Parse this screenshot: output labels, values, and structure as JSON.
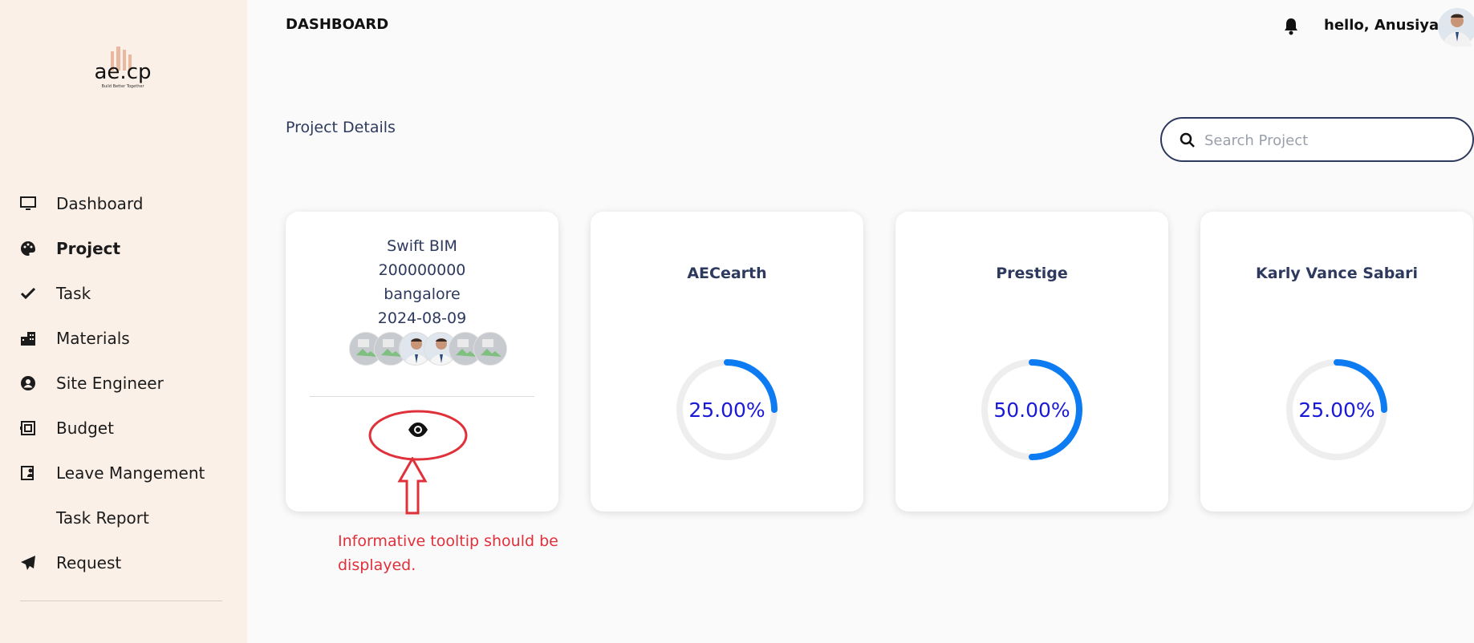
{
  "brand": {
    "logo_text": "ae.cp",
    "tagline": "Build Better Together",
    "accent": "#0d7cf2"
  },
  "sidebar": {
    "items": [
      {
        "label": "Dashboard",
        "icon": "monitor-icon",
        "active": false
      },
      {
        "label": "Project",
        "icon": "palette-icon",
        "active": true
      },
      {
        "label": "Task",
        "icon": "check-icon",
        "active": false
      },
      {
        "label": "Materials",
        "icon": "building-icon",
        "active": false
      },
      {
        "label": "Site Engineer",
        "icon": "user-circle-icon",
        "active": false
      },
      {
        "label": "Budget",
        "icon": "receipt-icon",
        "active": false
      },
      {
        "label": "Leave Mangement",
        "icon": "leave-icon",
        "active": false
      },
      {
        "label": "Task Report",
        "icon": "",
        "active": false
      },
      {
        "label": "Request",
        "icon": "send-icon",
        "active": false
      }
    ]
  },
  "header": {
    "title": "DASHBOARD",
    "greeting": "hello, Anusiya!",
    "bell_icon": "bell-icon",
    "avatar_icon": "user-avatar"
  },
  "main": {
    "section_title": "Project Details",
    "search": {
      "placeholder": "Search Project",
      "value": ""
    },
    "cards": [
      {
        "name": "Swift BIM",
        "number": "200000000",
        "location": "bangalore",
        "date": "2024-08-09",
        "team_count": 6,
        "view_icon": "eye-icon"
      },
      {
        "name": "AECearth",
        "progress_label": "25.00%",
        "progress": 0.25
      },
      {
        "name": "Prestige",
        "progress_label": "50.00%",
        "progress": 0.5
      },
      {
        "name": "Karly Vance Sabari",
        "progress_label": "25.00%",
        "progress": 0.25
      }
    ]
  },
  "annotation": {
    "text": "Informative tooltip should be displayed.",
    "color": "#e0303a"
  }
}
